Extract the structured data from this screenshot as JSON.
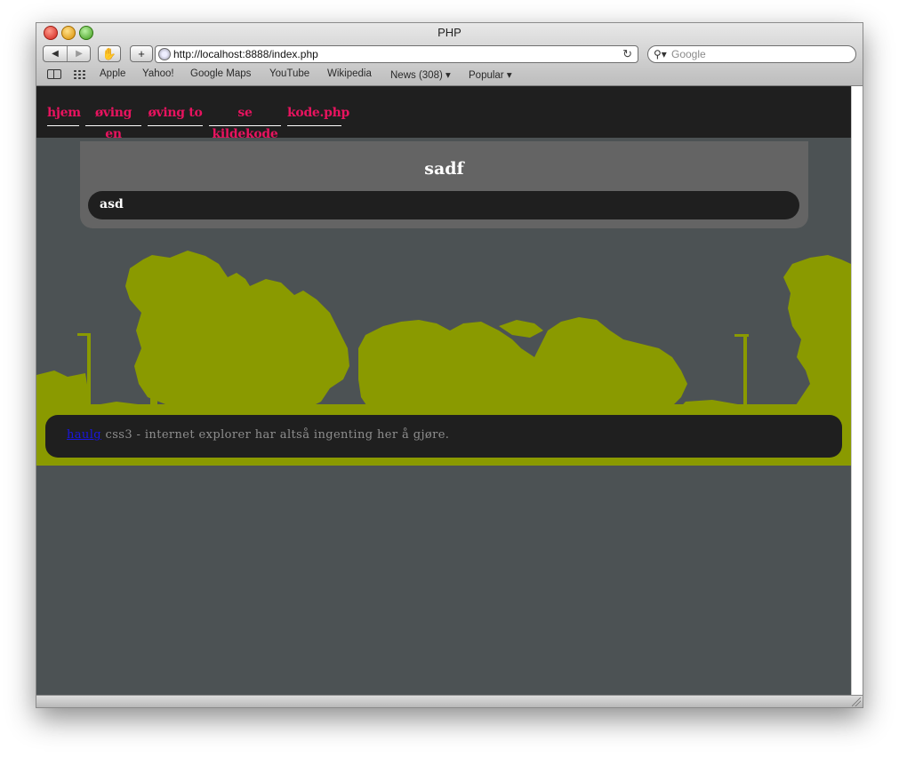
{
  "browser": {
    "window_title": "PHP",
    "url": "http://localhost:8888/index.php",
    "search_placeholder": "Google",
    "back_label": "◀",
    "forward_label": "▶",
    "add_label": "+",
    "reload_label": "↻",
    "bookmarks": [
      "Apple",
      "Yahoo!",
      "Google Maps",
      "YouTube",
      "Wikipedia",
      "News (308)",
      "Popular"
    ]
  },
  "nav": {
    "links": [
      "hjem",
      "øving en",
      "øving to",
      "se kildekode",
      "kode.php"
    ]
  },
  "panel": {
    "title": "sadf",
    "bar_text": "asd"
  },
  "footer": {
    "link_text": "haulg",
    "text": " css3 - internet explorer har altså ingenting her å gjøre."
  },
  "colors": {
    "nav_link": "#e8135f",
    "tree_green": "#8a9a00",
    "page_bg": "#4c5254"
  }
}
